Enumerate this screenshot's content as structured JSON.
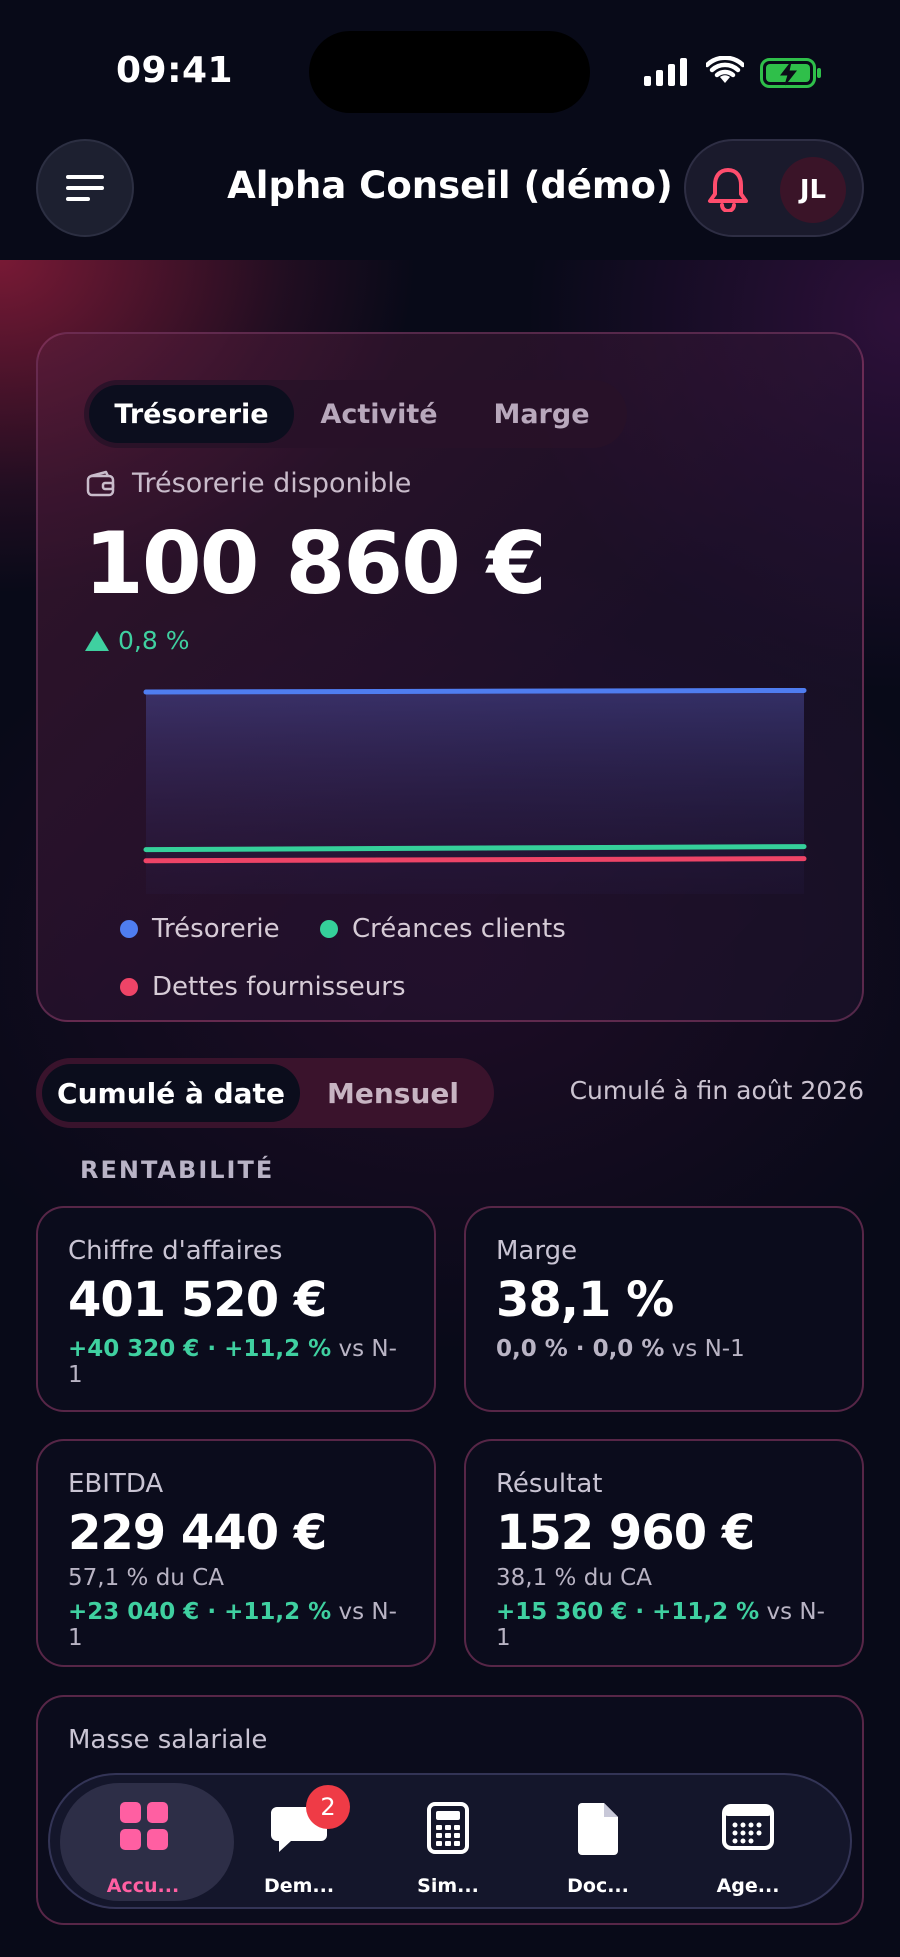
{
  "status_bar": {
    "time": "09:41"
  },
  "header": {
    "title": "Alpha Conseil (démo)",
    "avatar_initials": "JL"
  },
  "chart_card": {
    "tabs": [
      {
        "label": "Trésorerie",
        "active": true
      },
      {
        "label": "Activité",
        "active": false
      },
      {
        "label": "Marge",
        "active": false
      }
    ],
    "metric_label": "Trésorerie disponible",
    "metric_value": "100 860 €",
    "metric_change": "0,8 %",
    "metric_change_color": "#3fd0a0"
  },
  "chart_data": {
    "type": "area",
    "x": [
      "start",
      "end"
    ],
    "ylim": [
      0,
      110000
    ],
    "grid": false,
    "legend": "bottom",
    "series": [
      {
        "name": "Trésorerie",
        "color": "#4f7df0",
        "values": [
          100060,
          100860
        ]
      },
      {
        "name": "Créances clients",
        "color": "#35d09a",
        "values": [
          22000,
          23500
        ]
      },
      {
        "name": "Dettes fournisseurs",
        "color": "#ee4467",
        "values": [
          16500,
          17500
        ]
      }
    ]
  },
  "period": {
    "tabs": [
      {
        "label": "Cumulé à date",
        "active": true
      },
      {
        "label": "Mensuel",
        "active": false
      }
    ],
    "note": "Cumulé à fin août 2026"
  },
  "section_title": "RENTABILITÉ",
  "kpis": {
    "ca": {
      "label": "Chiffre d'affaires",
      "value": "401 520 €",
      "delta_abs": "+40 320 €",
      "sep": " · ",
      "delta_pct": "+11,2 %",
      "suffix": " vs N-1"
    },
    "marge": {
      "label": "Marge",
      "value": "38,1 %",
      "delta_abs": "0,0 %",
      "sep": " · ",
      "delta_pct": "0,0 %",
      "suffix": " vs N-1"
    },
    "ebitda": {
      "label": "EBITDA",
      "value": "229 440 €",
      "sub": "57,1 % du CA",
      "delta_abs": "+23 040 €",
      "sep": " · ",
      "delta_pct": "+11,2 %",
      "suffix": " vs N-1"
    },
    "resultat": {
      "label": "Résultat",
      "value": "152 960 €",
      "sub": "38,1 % du CA",
      "delta_abs": "+15 360 €",
      "sep": " · ",
      "delta_pct": "+11,2 %",
      "suffix": " vs N-1"
    },
    "masse": {
      "label": "Masse salariale"
    }
  },
  "bottom_nav": {
    "items": [
      {
        "label": "Accu...",
        "icon": "grid-icon",
        "active": true
      },
      {
        "label": "Dem...",
        "icon": "chat-bubble-icon",
        "badge": "2"
      },
      {
        "label": "Sim...",
        "icon": "calculator-icon"
      },
      {
        "label": "Doc...",
        "icon": "document-icon"
      },
      {
        "label": "Age...",
        "icon": "calendar-icon"
      }
    ]
  },
  "colors": {
    "accent_pink": "#ff5fa2",
    "positive": "#3fd0a0",
    "bell": "#ff4d6d",
    "badge": "#ef3b46"
  }
}
